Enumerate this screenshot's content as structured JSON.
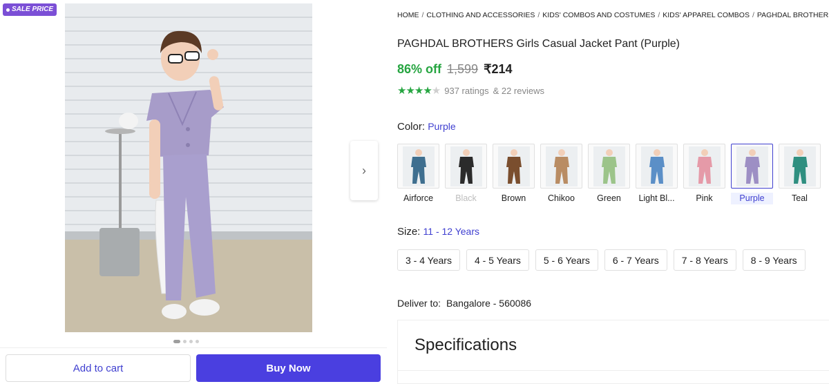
{
  "badge": {
    "label": "SALE PRICE"
  },
  "gallery": {
    "image_count": 4,
    "active_index": 0
  },
  "actions": {
    "add_to_cart": "Add to cart",
    "buy_now": "Buy Now"
  },
  "breadcrumb": [
    "HOME",
    "CLOTHING AND ACCESSORIES",
    "KIDS' COMBOS AND COSTUMES",
    "KIDS' APPAREL COMBOS",
    "PAGHDAL BROTHERS KIDS' AP"
  ],
  "product": {
    "title": "PAGHDAL BROTHERS Girls Casual Jacket Pant (Purple)",
    "discount": "86% off",
    "mrp": "1,599",
    "price": "₹214",
    "rating_stars": 4,
    "ratings": "937 ratings",
    "reviews": "& 22 reviews"
  },
  "color": {
    "label": "Color:",
    "selected": "Purple",
    "options": [
      {
        "name": "Airforce",
        "hex": "#3f6f8f",
        "state": "normal"
      },
      {
        "name": "Black",
        "hex": "#2b2b2b",
        "state": "disabled"
      },
      {
        "name": "Brown",
        "hex": "#7a4e2e",
        "state": "normal"
      },
      {
        "name": "Chikoo",
        "hex": "#b98c63",
        "state": "normal"
      },
      {
        "name": "Green",
        "hex": "#9cc48a",
        "state": "normal"
      },
      {
        "name": "Light Bl...",
        "hex": "#5b8fc7",
        "state": "normal"
      },
      {
        "name": "Pink",
        "hex": "#e59aa8",
        "state": "normal"
      },
      {
        "name": "Purple",
        "hex": "#9d8fc4",
        "state": "selected"
      },
      {
        "name": "Teal",
        "hex": "#2f8f80",
        "state": "normal"
      }
    ]
  },
  "size": {
    "label": "Size:",
    "selected": "11 - 12 Years",
    "options": [
      "3 - 4 Years",
      "4 - 5 Years",
      "5 - 6 Years",
      "6 - 7 Years",
      "7 - 8 Years",
      "8 - 9 Years"
    ]
  },
  "delivery": {
    "label": "Deliver to:",
    "location": "Bangalore - 560086"
  },
  "specifications": {
    "title": "Specifications"
  },
  "colors": {
    "accent": "#3f3fd0",
    "buy": "#4a3fe0",
    "discount": "#26a541",
    "badge": "#7b4fd6"
  }
}
